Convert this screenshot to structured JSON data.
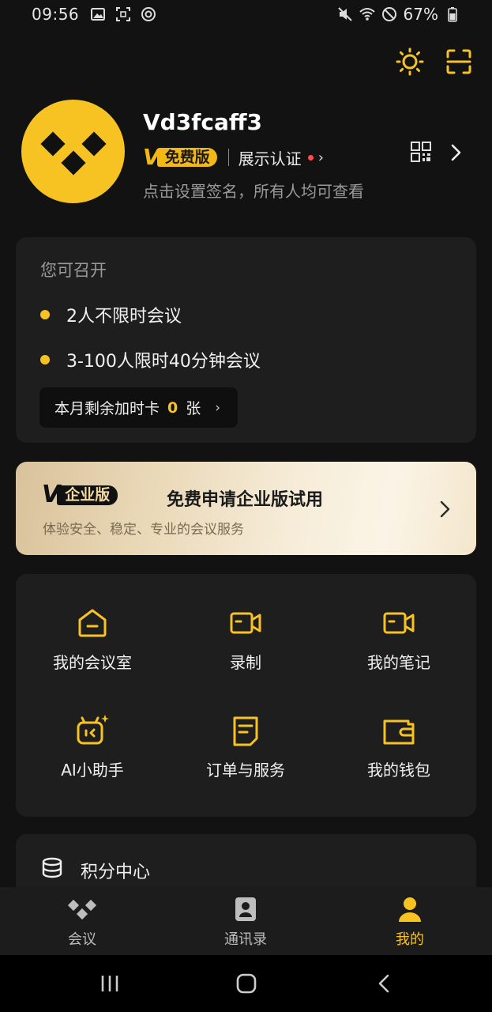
{
  "status_bar": {
    "time": "09:56",
    "battery": "67%"
  },
  "profile": {
    "username": "Vd3fcaff3",
    "badge_mark": "V",
    "badge_label": "免费版",
    "verify_label": "展示认证",
    "signature": "点击设置签名，所有人均可查看"
  },
  "meeting_card": {
    "title": "您可召开",
    "items": [
      "2人不限时会议",
      "3-100人限时40分钟会议"
    ],
    "extra_time_prefix": "本月剩余加时卡",
    "extra_time_count": "0",
    "extra_time_unit": "张"
  },
  "enterprise_banner": {
    "badge_mark": "V",
    "badge_label": "企业版",
    "title": "免费申请企业版试用",
    "subtitle": "体验安全、稳定、专业的会议服务"
  },
  "features": [
    {
      "label": "我的会议室",
      "icon": "meeting-room-icon"
    },
    {
      "label": "录制",
      "icon": "video-record-icon"
    },
    {
      "label": "我的笔记",
      "icon": "notes-icon"
    },
    {
      "label": "AI小助手",
      "icon": "ai-assistant-icon"
    },
    {
      "label": "订单与服务",
      "icon": "orders-icon"
    },
    {
      "label": "我的钱包",
      "icon": "wallet-icon"
    }
  ],
  "points": {
    "title": "积分中心"
  },
  "tabs": [
    {
      "label": "会议",
      "icon": "meeting-tab-icon",
      "active": false
    },
    {
      "label": "通讯录",
      "icon": "contacts-tab-icon",
      "active": false
    },
    {
      "label": "我的",
      "icon": "profile-tab-icon",
      "active": true
    }
  ],
  "colors": {
    "accent": "#f7c322",
    "background": "#121212",
    "card": "#1e1e1e"
  }
}
